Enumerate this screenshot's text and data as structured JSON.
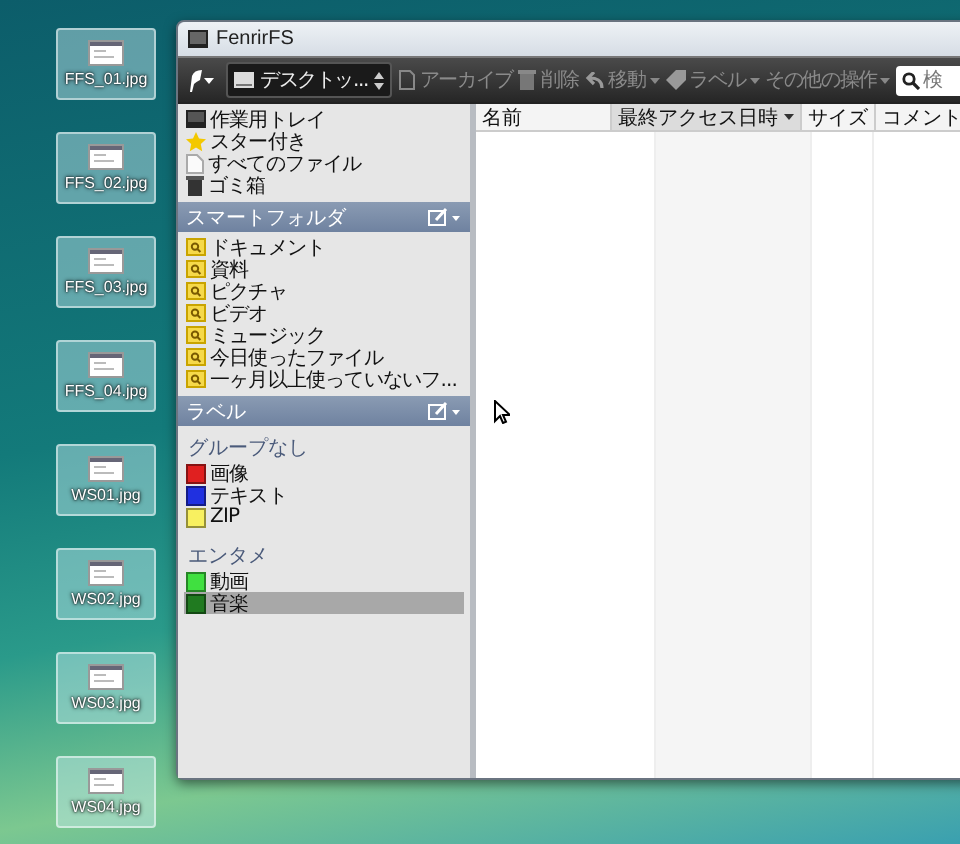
{
  "desktop_icons": [
    {
      "label": "FFS_01.jpg"
    },
    {
      "label": "FFS_02.jpg"
    },
    {
      "label": "FFS_03.jpg"
    },
    {
      "label": "FFS_04.jpg"
    },
    {
      "label": "WS01.jpg"
    },
    {
      "label": "WS02.jpg"
    },
    {
      "label": "WS03.jpg"
    },
    {
      "label": "WS04.jpg"
    }
  ],
  "window": {
    "title": "FenrirFS"
  },
  "toolbar": {
    "location": "デスクトッ...",
    "buttons": [
      {
        "label": "アーカイブ",
        "kind": "archive",
        "dropdown": false
      },
      {
        "label": "削除",
        "kind": "trash",
        "dropdown": false
      },
      {
        "label": "移動",
        "kind": "move",
        "dropdown": true
      },
      {
        "label": "ラベル",
        "kind": "tag",
        "dropdown": true
      },
      {
        "label": "その他の操作",
        "kind": "more",
        "dropdown": true
      }
    ],
    "search": {
      "placeholder": "検"
    }
  },
  "sidebar": {
    "places": [
      {
        "label": "作業用トレイ",
        "kind": "tray"
      },
      {
        "label": "スター付き",
        "kind": "star"
      },
      {
        "label": "すべてのファイル",
        "kind": "file"
      },
      {
        "label": "ゴミ箱",
        "kind": "trash"
      }
    ],
    "smart_folders": {
      "title": "スマートフォルダ",
      "items": [
        {
          "label": "ドキュメント"
        },
        {
          "label": "資料"
        },
        {
          "label": "ピクチャ"
        },
        {
          "label": "ビデオ"
        },
        {
          "label": "ミュージック"
        },
        {
          "label": "今日使ったファイル"
        },
        {
          "label": "一ヶ月以上使っていないフ..."
        }
      ]
    },
    "labels": {
      "title": "ラベル",
      "groups": [
        {
          "name": "グループなし",
          "items": [
            {
              "label": "画像",
              "color": "#e02020",
              "selected": false
            },
            {
              "label": "テキスト",
              "color": "#2030e0",
              "selected": false
            },
            {
              "label": "ZIP",
              "color": "#f8f060",
              "selected": false
            }
          ]
        },
        {
          "name": "エンタメ",
          "items": [
            {
              "label": "動画",
              "color": "#40e040",
              "selected": false
            },
            {
              "label": "音楽",
              "color": "#207a20",
              "selected": true
            }
          ]
        }
      ]
    }
  },
  "file_list": {
    "columns": [
      {
        "label": "名前",
        "sorted": false
      },
      {
        "label": "最終アクセス日時",
        "sorted": true
      },
      {
        "label": "サイズ",
        "sorted": false
      },
      {
        "label": "コメント",
        "sorted": false
      }
    ]
  }
}
